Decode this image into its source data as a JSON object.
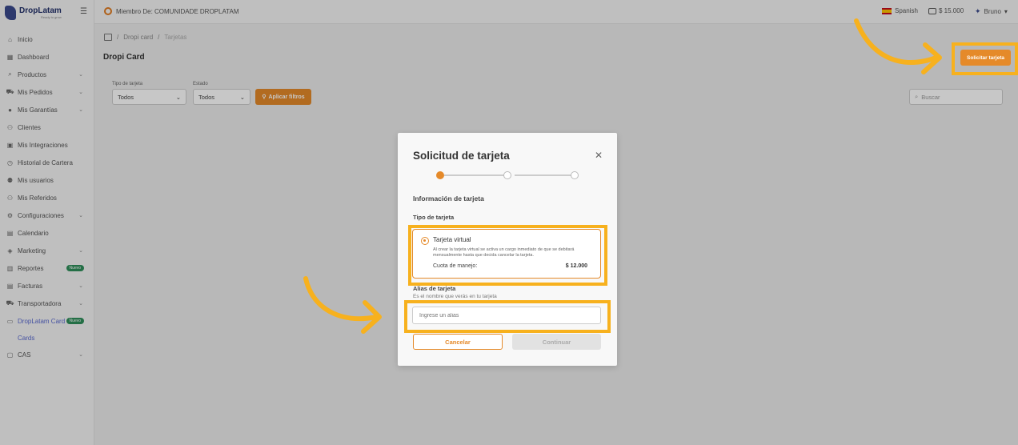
{
  "app": {
    "logo_text": "DropLatam",
    "logo_sub": "Ready to grow"
  },
  "sidebar": {
    "items": [
      {
        "label": "Inicio",
        "icon": "home-icon",
        "chevron": false
      },
      {
        "label": "Dashboard",
        "icon": "dashboard-icon",
        "chevron": false
      },
      {
        "label": "Productos",
        "icon": "search-icon",
        "chevron": true
      },
      {
        "label": "Mis Pedidos",
        "icon": "truck-icon",
        "chevron": true
      },
      {
        "label": "Mis Garantías",
        "icon": "shield-icon",
        "chevron": true
      },
      {
        "label": "Clientes",
        "icon": "users-icon",
        "chevron": false
      },
      {
        "label": "Mis Integraciones",
        "icon": "plug-icon",
        "chevron": false
      },
      {
        "label": "Historial de Cartera",
        "icon": "history-icon",
        "chevron": false
      },
      {
        "label": "Mis usuarios",
        "icon": "user-icon",
        "chevron": false
      },
      {
        "label": "Mis Referidos",
        "icon": "referral-icon",
        "chevron": false
      },
      {
        "label": "Configuraciones",
        "icon": "gear-icon",
        "chevron": true
      },
      {
        "label": "Calendario",
        "icon": "calendar-icon",
        "chevron": false
      },
      {
        "label": "Marketing",
        "icon": "megaphone-icon",
        "chevron": true
      },
      {
        "label": "Reportes",
        "icon": "chart-icon",
        "badge": "Nuevo"
      },
      {
        "label": "Facturas",
        "icon": "invoice-icon",
        "chevron": true
      },
      {
        "label": "Transportadora",
        "icon": "truck-icon",
        "chevron": true
      },
      {
        "label": "DropLatam Card",
        "icon": "card-icon",
        "badge": "Nuevo",
        "active": true
      }
    ],
    "sub_item": "Cards",
    "last_item": {
      "label": "CAS",
      "icon": "cas-icon"
    }
  },
  "topbar": {
    "member_text": "Miembro De: COMUNIDADE DROPLATAM",
    "language": "Spanish",
    "wallet": "$ 15.000",
    "user": "Bruno"
  },
  "page": {
    "breadcrumb": [
      "Dropi card",
      "Tarjetas"
    ],
    "title": "Dropi Card",
    "request_button": "Solicitar tarjeta"
  },
  "filters": {
    "card_type_label": "Tipo de tarjeta",
    "card_type_value": "Todos",
    "status_label": "Estado",
    "status_value": "Todos",
    "apply_button": "Aplicar filtros",
    "search_placeholder": "Buscar"
  },
  "modal": {
    "title": "Solicitud de tarjeta",
    "step_count": 3,
    "current_step": 1,
    "section_title": "Información de tarjeta",
    "card_type_label": "Tipo de tarjeta",
    "option_title": "Tarjeta virtual",
    "option_desc": "Al crear la tarjeta virtual se activa un cargo inmediato de que se debitará mensualmente hasta que decida cancelar la tarjeta.",
    "fee_label": "Cuota de manejo:",
    "fee_value": "$ 12.000",
    "alias_label": "Alias de tarjeta",
    "alias_hint": "Es el nombre que verás en tu tarjeta",
    "alias_placeholder": "Ingrese un alias",
    "cancel_button": "Cancelar",
    "continue_button": "Continuar"
  },
  "colors": {
    "accent": "#e58a2a",
    "annotation": "#f7b11e",
    "brand": "#3a4a8c"
  }
}
